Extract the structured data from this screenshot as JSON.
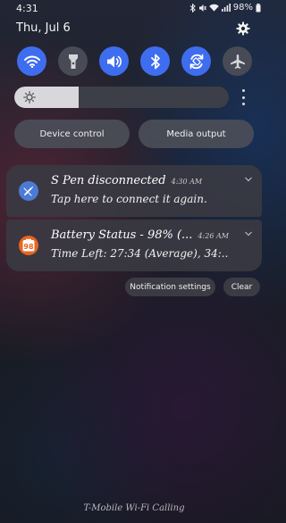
{
  "status_bar": {
    "time": "4:31",
    "battery": "98%"
  },
  "header": {
    "date": "Thu, Jul 6"
  },
  "quick_settings": [
    {
      "name": "wifi",
      "icon": "wifi-icon",
      "active": true
    },
    {
      "name": "flashlight",
      "icon": "flashlight-icon",
      "active": false
    },
    {
      "name": "sound",
      "icon": "volume-icon",
      "active": true
    },
    {
      "name": "bluetooth",
      "icon": "bluetooth-icon",
      "active": true
    },
    {
      "name": "auto-rotate",
      "icon": "rotate-icon",
      "active": true
    },
    {
      "name": "airplane-mode",
      "icon": "airplane-icon",
      "active": false
    }
  ],
  "brightness": {
    "level": 0.3
  },
  "buttons": {
    "device_control": "Device control",
    "media_output": "Media output"
  },
  "notifications": [
    {
      "title": "S Pen disconnected",
      "time": "4:30 AM",
      "body": "Tap here to connect it again.",
      "icon": "s-pen-icon",
      "icon_color": "#4c7bd6"
    },
    {
      "title": "Battery Status - 98% (...",
      "time": "4:26 AM",
      "body": "Time Left: 27:34 (Average), 34:..",
      "icon": "battery-app-icon",
      "icon_color": "#e8651f",
      "icon_text": "98"
    }
  ],
  "actions": {
    "notification_settings": "Notification settings",
    "clear": "Clear"
  },
  "carrier": "T-Mobile Wi-Fi Calling",
  "colors": {
    "accent": "#3f6df0",
    "tile_off": "#484b55",
    "card": "#3a3a42"
  }
}
